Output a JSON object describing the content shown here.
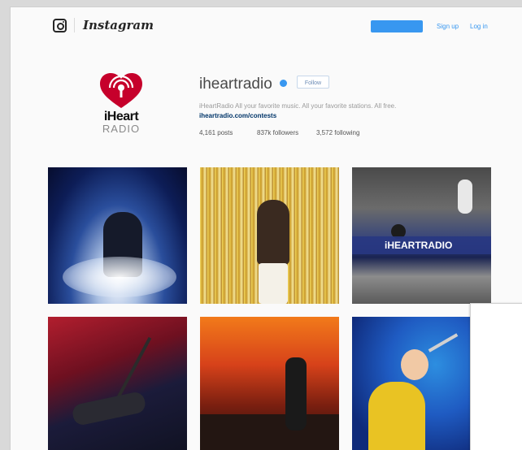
{
  "header": {
    "brand": "Instagram",
    "signup_label": "Sign up",
    "login_label": "Log in"
  },
  "profile": {
    "avatar_logo_top": "iHeart",
    "avatar_logo_bottom": "RADIO",
    "username": "iheartradio",
    "follow_label": "Follow",
    "bio": "iHeartRadio All your favorite music. All your favorite stations. All free.",
    "bio_link": "iheartradio.com/contests",
    "stats": {
      "posts": "4,161",
      "posts_label": "posts",
      "followers": "837k",
      "followers_label": "followers",
      "following": "3,572",
      "following_label": "following"
    }
  },
  "grid": {
    "tile3_banner_text": "iHEARTRADIO"
  },
  "colors": {
    "accent": "#3897f0",
    "brand_red": "#c6002b"
  }
}
